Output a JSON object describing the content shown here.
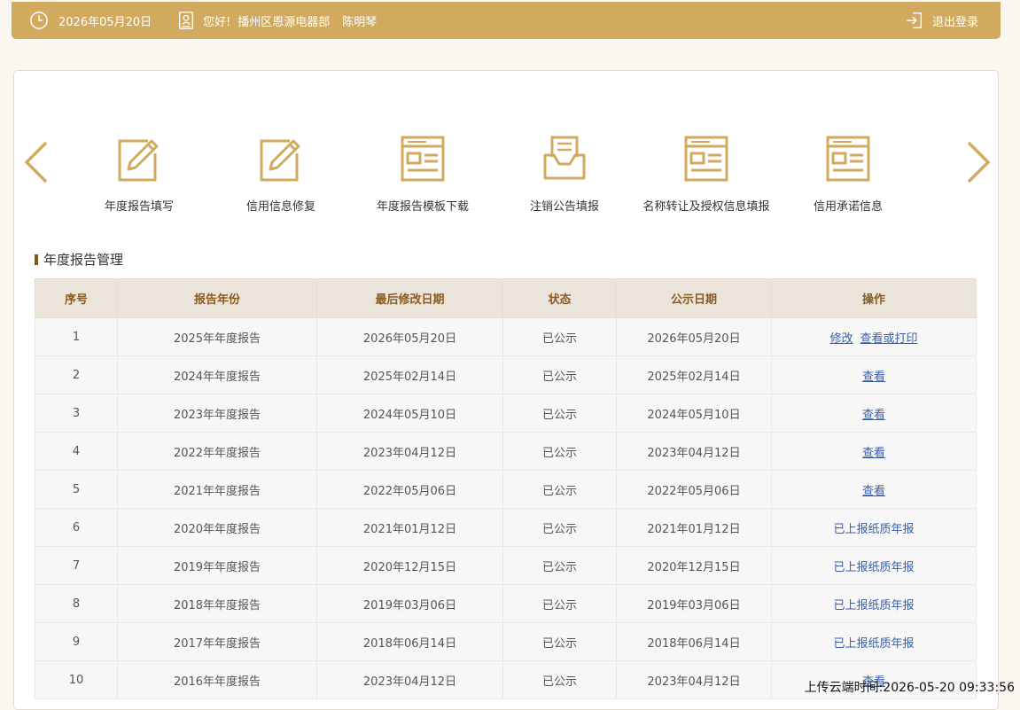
{
  "header": {
    "date": "2026年05月20日",
    "greeting": "您好!",
    "company": "播州区恩源电器部",
    "user": "陈明琴",
    "logout": "退出登录"
  },
  "functions": [
    {
      "label": "年度报告填写",
      "icon": "edit-form-icon"
    },
    {
      "label": "信用信息修复",
      "icon": "edit-form-icon"
    },
    {
      "label": "年度报告模板下载",
      "icon": "document-template-icon"
    },
    {
      "label": "注销公告填报",
      "icon": "inbox-tray-icon"
    },
    {
      "label": "名称转让及授权信息填报",
      "icon": "document-template-icon"
    },
    {
      "label": "信用承诺信息",
      "icon": "document-template-icon"
    }
  ],
  "section": {
    "title": "年度报告管理"
  },
  "table": {
    "headers": [
      "序号",
      "报告年份",
      "最后修改日期",
      "状态",
      "公示日期",
      "操作"
    ],
    "rows": [
      {
        "no": "1",
        "year": "2025年年度报告",
        "modified": "2026年05月20日",
        "status": "已公示",
        "published": "2026年05月20日",
        "actions": [
          "修改",
          "查看或打印"
        ],
        "note": ""
      },
      {
        "no": "2",
        "year": "2024年年度报告",
        "modified": "2025年02月14日",
        "status": "已公示",
        "published": "2025年02月14日",
        "actions": [
          "查看"
        ],
        "note": ""
      },
      {
        "no": "3",
        "year": "2023年年度报告",
        "modified": "2024年05月10日",
        "status": "已公示",
        "published": "2024年05月10日",
        "actions": [
          "查看"
        ],
        "note": ""
      },
      {
        "no": "4",
        "year": "2022年年度报告",
        "modified": "2023年04月12日",
        "status": "已公示",
        "published": "2023年04月12日",
        "actions": [
          "查看"
        ],
        "note": ""
      },
      {
        "no": "5",
        "year": "2021年年度报告",
        "modified": "2022年05月06日",
        "status": "已公示",
        "published": "2022年05月06日",
        "actions": [
          "查看"
        ],
        "note": ""
      },
      {
        "no": "6",
        "year": "2020年年度报告",
        "modified": "2021年01月12日",
        "status": "已公示",
        "published": "2021年01月12日",
        "actions": [],
        "note": "已上报纸质年报"
      },
      {
        "no": "7",
        "year": "2019年年度报告",
        "modified": "2020年12月15日",
        "status": "已公示",
        "published": "2020年12月15日",
        "actions": [],
        "note": "已上报纸质年报"
      },
      {
        "no": "8",
        "year": "2018年年度报告",
        "modified": "2019年03月06日",
        "status": "已公示",
        "published": "2019年03月06日",
        "actions": [],
        "note": "已上报纸质年报"
      },
      {
        "no": "9",
        "year": "2017年年度报告",
        "modified": "2018年06月14日",
        "status": "已公示",
        "published": "2018年06月14日",
        "actions": [],
        "note": "已上报纸质年报"
      },
      {
        "no": "10",
        "year": "2016年年度报告",
        "modified": "2023年04月12日",
        "status": "已公示",
        "published": "2023年04月12日",
        "actions": [
          "查看"
        ],
        "note": ""
      }
    ]
  },
  "upload_time": "上传云端时间:2026-05-20 09:33:56",
  "colors": {
    "accent": "#d1aa60",
    "header_text": "#8a5a1f",
    "link": "#3a5fa8"
  }
}
